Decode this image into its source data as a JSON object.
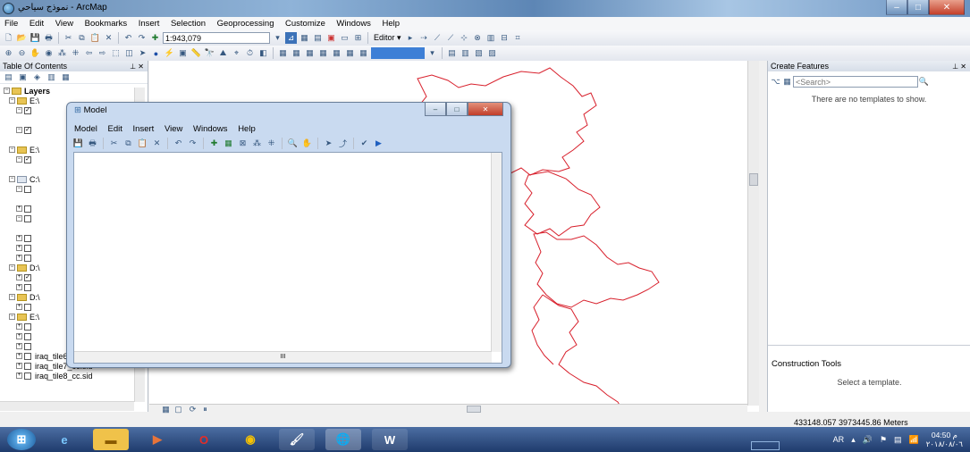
{
  "window": {
    "title": "نموذج سياحي - ArcMap",
    "min": "–",
    "max": "□",
    "close": "✕"
  },
  "menu": [
    "File",
    "Edit",
    "View",
    "Bookmarks",
    "Insert",
    "Selection",
    "Geoprocessing",
    "Customize",
    "Windows",
    "Help"
  ],
  "toolbar": {
    "scale": "1:943,079",
    "editor_label": "Editor ▾"
  },
  "toc": {
    "title": "Table Of Contents",
    "pin": "⊥ ✕",
    "layers_label": "Layers",
    "rows": [
      "E:\\",
      "",
      "",
      "E:\\",
      "",
      "C:\\",
      "",
      "",
      "",
      "",
      "",
      "",
      "D:\\",
      "",
      "",
      "D:\\",
      "",
      "E:\\",
      "",
      "",
      "iraq_tile6_cc.sid",
      "iraq_tile7_cc.sid",
      "iraq_tile8_cc.sid"
    ]
  },
  "create_features": {
    "title": "Create Features",
    "search_placeholder": "<Search>",
    "message": "There are no templates to show.",
    "construction_title": "Construction Tools",
    "construction_message": "Select a template."
  },
  "status": {
    "coords": "433148.057  3973445.86 Meters"
  },
  "model": {
    "title": "Model",
    "menu": [
      "Model",
      "Edit",
      "Insert",
      "View",
      "Windows",
      "Help"
    ],
    "hscroll_label": "III"
  },
  "taskbar": {
    "lang": "AR",
    "time": "04:50 م",
    "date": "٢٠١٨/٠٨/٠٦"
  },
  "colors": {
    "boundary": "#d8202c"
  }
}
